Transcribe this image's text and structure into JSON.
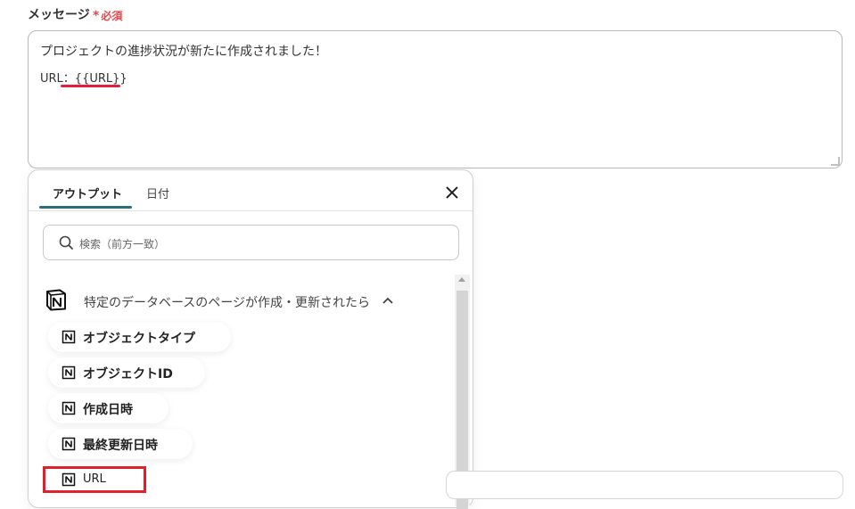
{
  "field": {
    "label": "メッセージ",
    "required_star": "*",
    "required_text": "必須"
  },
  "message": {
    "line1": "プロジェクトの進捗状況が新たに作成されました！",
    "line2_prefix": "URL：",
    "line2_var": "{{URL}}"
  },
  "popup": {
    "tabs": [
      {
        "label": "アウトプット",
        "active": true
      },
      {
        "label": "日付",
        "active": false
      }
    ],
    "close_icon": "close-icon",
    "search": {
      "placeholder": "検索（前方一致）"
    },
    "section": {
      "title": "特定のデータベースのページが作成・更新されたら",
      "expanded": true
    },
    "items": [
      {
        "label": "オブジェクトタイプ"
      },
      {
        "label": "オブジェクトID"
      },
      {
        "label": "作成日時"
      },
      {
        "label": "最終更新日時"
      },
      {
        "label": "URL"
      }
    ]
  },
  "colors": {
    "accent": "#2b6e7b",
    "required": "#e5484d",
    "highlight": "#e0202a"
  }
}
